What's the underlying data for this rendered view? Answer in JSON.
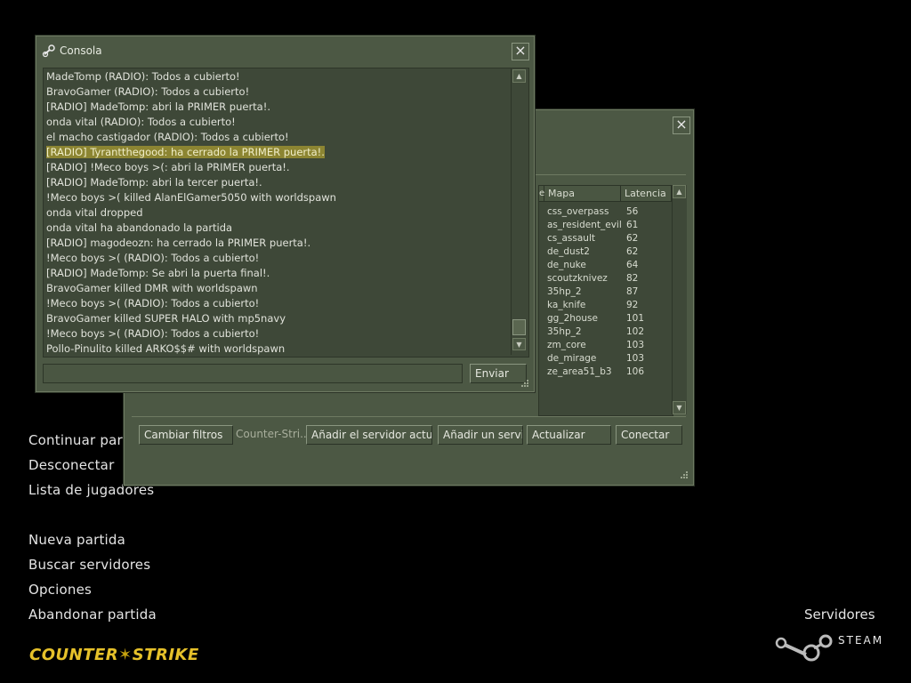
{
  "main_menu": {
    "items": [
      "Continuar partida",
      "Desconectar",
      "Lista de jugadores",
      "Nueva partida",
      "Buscar servidores",
      "Opciones",
      "Abandonar partida"
    ]
  },
  "logo": {
    "left": "COUNTER",
    "right": "STRIKE"
  },
  "servidores_label": "Servidores",
  "steam_label": "STEAM",
  "server_browser": {
    "close": "×",
    "columns": {
      "partial": "es",
      "map": "Mapa",
      "latency": "Latencia"
    },
    "rows": [
      {
        "map": "css_overpass",
        "latency": "56"
      },
      {
        "map": "as_resident_evil",
        "latency": "61"
      },
      {
        "map": "cs_assault",
        "latency": "62"
      },
      {
        "map": "de_dust2",
        "latency": "62"
      },
      {
        "map": "de_nuke",
        "latency": "64"
      },
      {
        "map": "scoutzknivez",
        "latency": "82"
      },
      {
        "map": "35hp_2",
        "latency": "87"
      },
      {
        "map": "ka_knife",
        "latency": "92"
      },
      {
        "map": "gg_2house",
        "latency": "101"
      },
      {
        "map": "35hp_2",
        "latency": "102"
      },
      {
        "map": "zm_core",
        "latency": "103"
      },
      {
        "map": "de_mirage",
        "latency": "103"
      },
      {
        "map": "ze_area51_b3",
        "latency": "106"
      }
    ],
    "buttons": {
      "filters": "Cambiar filtros",
      "game_label": "Counter-Stri...",
      "add_current": "Añadir el servidor actual",
      "add_server": "Añadir un servi...",
      "refresh": "Actualizar",
      "connect": "Conectar"
    }
  },
  "console": {
    "title": "Consola",
    "close": "×",
    "lines": [
      "MadeTomp (RADIO): Todos a cubierto!",
      "BravoGamer (RADIO): Todos a cubierto!",
      "[RADIO] MadeTomp: abri la PRIMER puerta!.",
      "onda vital (RADIO): Todos a cubierto!",
      "el macho castigador (RADIO): Todos a cubierto!",
      "[RADIO] Tyrantthegood: ha cerrado la PRIMER puerta!.",
      "[RADIO] !Meco boys >(: abri la PRIMER puerta!.",
      "[RADIO] MadeTomp: abri la tercer puerta!.",
      "!Meco boys >( killed AlanElGamer5050 with worldspawn",
      "onda vital dropped",
      "onda vital ha abandonado la partida",
      "[RADIO] magodeozn: ha cerrado la PRIMER puerta!.",
      "!Meco boys >( (RADIO): Todos a cubierto!",
      "[RADIO] MadeTomp: Se abri la puerta final!.",
      "BravoGamer killed DMR with worldspawn",
      "!Meco boys >( (RADIO): Todos a cubierto!",
      "BravoGamer killed SUPER HALO with mp5navy",
      "!Meco boys >( (RADIO): Todos a cubierto!",
      "Pollo-Pinulito killed ARKO$$# with worldspawn"
    ],
    "highlight_index": 5,
    "input_value": "",
    "send_label": "Enviar"
  },
  "colors": {
    "panel": "#4c5844",
    "highlight": "#8c8532",
    "logo": "#e6c12a"
  }
}
